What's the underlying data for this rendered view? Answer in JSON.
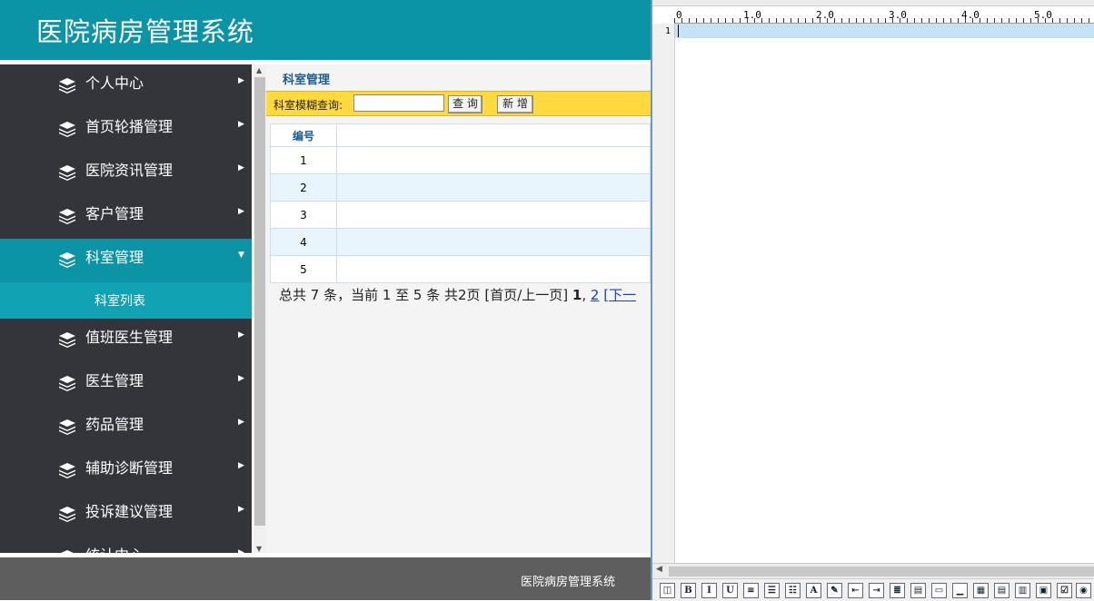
{
  "app": {
    "title": "医院病房管理系统"
  },
  "sidebar": {
    "items": [
      {
        "label": "个人中心",
        "icon": "layers-icon",
        "expanded": false
      },
      {
        "label": "首页轮播管理",
        "icon": "layers-icon",
        "expanded": false
      },
      {
        "label": "医院资讯管理",
        "icon": "layers-icon",
        "expanded": false
      },
      {
        "label": "客户管理",
        "icon": "layers-icon",
        "expanded": false
      },
      {
        "label": "科室管理",
        "icon": "layers-icon",
        "expanded": true
      },
      {
        "label": "值班医生管理",
        "icon": "layers-icon",
        "expanded": false
      },
      {
        "label": "医生管理",
        "icon": "layers-icon",
        "expanded": false
      },
      {
        "label": "药品管理",
        "icon": "layers-icon",
        "expanded": false
      },
      {
        "label": "辅助诊断管理",
        "icon": "layers-icon",
        "expanded": false
      },
      {
        "label": "投诉建议管理",
        "icon": "layers-icon",
        "expanded": false
      },
      {
        "label": "统计中心",
        "icon": "layers-icon",
        "expanded": false
      }
    ],
    "subitem": {
      "label": "科室列表"
    }
  },
  "main": {
    "page_title": "科室管理",
    "search": {
      "label": "科室模糊查询:",
      "value": "",
      "query_button": "查 询",
      "add_button": "新 增"
    },
    "table": {
      "headers": [
        "编号",
        ""
      ],
      "rows": [
        {
          "num": "1",
          "name": ""
        },
        {
          "num": "2",
          "name": ""
        },
        {
          "num": "3",
          "name": ""
        },
        {
          "num": "4",
          "name": ""
        },
        {
          "num": "5",
          "name": ""
        }
      ]
    },
    "pager": {
      "summary": "总共 7 条，当前 1 至 5 条 共2页",
      "first_prev": "[首页/上一页]",
      "current_page": "1",
      "sep": ",",
      "page2": "2",
      "next": "[下一"
    }
  },
  "footer": {
    "text": "医院病房管理系统"
  },
  "editor": {
    "ruler_labels": [
      "0",
      "1.0",
      "2.0",
      "3.0",
      "4.0",
      "5.0"
    ],
    "line_number": "1",
    "toolbar_icons": [
      "view-source-icon",
      "bold-icon",
      "italic-icon",
      "underline-icon",
      "align-icon",
      "bullet-list-icon",
      "numbered-list-icon",
      "font-color-icon",
      "highlight-icon",
      "outdent-icon",
      "indent-icon",
      "align-right-icon",
      "justify-icon",
      "frame-icon",
      "rule-icon",
      "textbox-icon",
      "listbox-icon",
      "dropdown-icon",
      "spin-icon",
      "table-icon",
      "checkbox-icon",
      "radio-icon"
    ],
    "toolbar_glyphs": [
      "◫",
      "B",
      "I",
      "U",
      "≡",
      "☰",
      "☷",
      "A",
      "✎",
      "⇤",
      "⇥",
      "≣",
      "▤",
      "▭",
      "▁",
      "▦",
      "▤",
      "▥",
      "▣",
      "▧",
      "☑",
      "◉"
    ]
  },
  "colors": {
    "header": "#0b94a6",
    "sidebar": "#34353b",
    "active_item": "#0b94a6",
    "subitem": "#11a2b4",
    "searchbar": "#ffd940",
    "footer": "#5e5e5e",
    "row_alt": "#e9f5fc",
    "line_highlight": "#c5e3f7"
  }
}
